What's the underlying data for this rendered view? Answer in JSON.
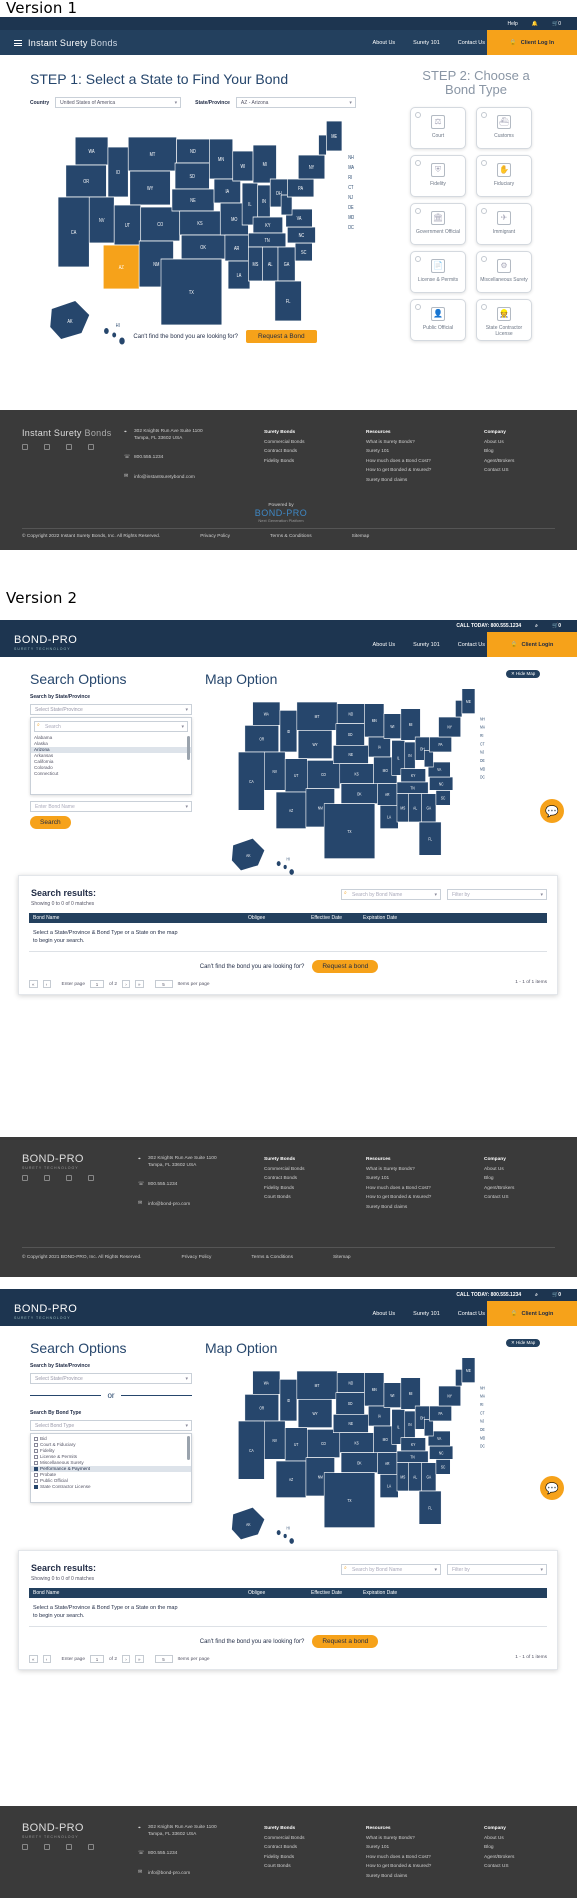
{
  "version1": {
    "label": "Version 1",
    "topbar": {
      "help": "Help",
      "cart_count": "0"
    },
    "nav": {
      "logo_a": "Instant Surety",
      "logo_b": "Bonds",
      "links": [
        "About Us",
        "Surety 101",
        "Contact Us"
      ],
      "login": "Client Log In"
    },
    "step1": {
      "title": "STEP 1: Select a State to Find Your Bond",
      "country_label": "Country",
      "country_value": "United States of America",
      "state_label": "State/Province",
      "state_value": "AZ - Arizona"
    },
    "step2": {
      "title": "STEP 2: Choose a Bond Type",
      "cards": [
        "Court",
        "Customs",
        "Fidelity",
        "Fiduciary",
        "Government Official",
        "Immigrant",
        "License & Permits",
        "Miscellaneous Surety",
        "Public Official",
        "State Contractor License"
      ]
    },
    "cta": {
      "text": "Can't find the bond you are looking for?",
      "button": "Request a Bond"
    },
    "footer": {
      "logo_a": "Instant Surety",
      "logo_b": "Bonds",
      "address": [
        "302 Knights Run Ave Suite 1100",
        "Tampa, FL 33602 USA"
      ],
      "phone": "800.555.1234",
      "email": "info@instantsuretybond.com",
      "surety_bonds": {
        "title": "Surety Bonds",
        "items": [
          "Commercial Bonds",
          "Contract Bonds",
          "Fidelity Bonds"
        ]
      },
      "resources": {
        "title": "Resources",
        "items": [
          "What is Surety Bonds?",
          "Surety 101",
          "How much does a Bond Cost?",
          "How to get Bonded & Insured?",
          "Surety Bond claims"
        ]
      },
      "company": {
        "title": "Company",
        "items": [
          "About Us",
          "Blog",
          "Agent/Brokers",
          "Contact US"
        ]
      },
      "powered_by": "Powered by",
      "powered_logo": "BOND-PRO",
      "powered_sub": "Next Generation Platform",
      "copyright": "© Copyright 2022 Instant Surety Bonds, Inc. All Rights Reserved.",
      "links": [
        "Privacy Policy",
        "Terms & Conditions",
        "Sitemap"
      ]
    }
  },
  "version2": {
    "label": "Version 2",
    "topbar": {
      "call": "CALL TODAY: 800.555.1234",
      "cart_count": "0"
    },
    "nav": {
      "logo": "BOND-PRO",
      "logo_sub": "SURETY TECHNOLOGY",
      "links": [
        "About Us",
        "Surety 101",
        "Contact Us"
      ],
      "login": "Client Login"
    },
    "search": {
      "title": "Search Options",
      "state_label": "Search by State/Province",
      "state_placeholder": "Select State/Province",
      "search_placeholder": "Search",
      "states": [
        "Alabama",
        "Alaska",
        "Arizona",
        "Arkansas",
        "California",
        "Colorado",
        "Connecticut"
      ],
      "bond_name_placeholder": "Enter Bond Name",
      "button": "Search",
      "or": "or",
      "type_label": "Search By Bond Type",
      "type_placeholder": "Select Bond Type",
      "types": [
        "Bid",
        "Court & Fiduciary",
        "Fidelity",
        "License & Permits",
        "Miscellaneous Surety",
        "Performance & Payment",
        "Probate",
        "Public Official",
        "State Contractor License"
      ]
    },
    "map": {
      "title": "Map Option",
      "hide": "Hide Map"
    },
    "results": {
      "title": "Search results:",
      "count": "Showing 0 to 0 of 0 matches",
      "search_placeholder": "Search by Bond Name",
      "filter_placeholder": "Filter by",
      "columns": [
        "Bond Name",
        "Obligee",
        "Effective Date",
        "Expiration Date"
      ],
      "empty_line1": "Select a State/Province & Bond Type or a State on the map",
      "empty_line2": "to begin your search.",
      "cta_text": "Can't find the bond you are looking for?",
      "cta_button": "Request a bond",
      "enter_page": "Enter page",
      "page": "1",
      "of": "of 2",
      "per_page_value": "5",
      "per_page": "Items per page",
      "range": "1 - 1 of 1 items"
    },
    "footer": {
      "logo": "BOND-PRO",
      "logo_sub": "SURETY TECHNOLOGY",
      "address": [
        "302 Knights Run Ave Suite 1100",
        "Tampa, FL 33602 USA"
      ],
      "phone": "800.555.1234",
      "email": "info@bond-pro.com",
      "surety_bonds": {
        "title": "Surety Bonds",
        "items": [
          "Commercial Bonds",
          "Contract Bonds",
          "Fidelity Bonds",
          "Court Bonds"
        ]
      },
      "resources": {
        "title": "Resources",
        "items": [
          "What is Surety Bonds?",
          "Surety 101",
          "How much does a Bond Cost?",
          "How to get Bonded & Insured?",
          "Surety Bond claims"
        ]
      },
      "company": {
        "title": "Company",
        "items": [
          "About Us",
          "Blog",
          "Agent/Brokers",
          "Contact US"
        ]
      },
      "copyright": "© Copyright 2021 BOND-PRO, Inc. All Rights Reserved.",
      "links": [
        "Privacy Policy",
        "Terms & Conditions",
        "Sitemap"
      ]
    }
  },
  "map_labels": {
    "states": [
      "WA",
      "OR",
      "CA",
      "ID",
      "NV",
      "MT",
      "WY",
      "UT",
      "AZ",
      "CO",
      "NM",
      "ND",
      "SD",
      "NE",
      "KS",
      "OK",
      "TX",
      "MN",
      "IA",
      "MO",
      "AR",
      "LA",
      "WI",
      "IL",
      "MI",
      "IN",
      "OH",
      "KY",
      "TN",
      "MS",
      "AL",
      "GA",
      "FL",
      "SC",
      "NC",
      "VA",
      "WV",
      "PA",
      "NY",
      "VT",
      "ME",
      "AK",
      "HI"
    ],
    "northeast": [
      "NH",
      "MA",
      "RI",
      "CT",
      "NJ",
      "DE",
      "MD",
      "DC"
    ]
  },
  "colors": {
    "navy": "#23405e",
    "orange": "#f6a21a",
    "map": "#26466c",
    "selected": "#f6a21a",
    "footer": "#3a3a3a"
  }
}
